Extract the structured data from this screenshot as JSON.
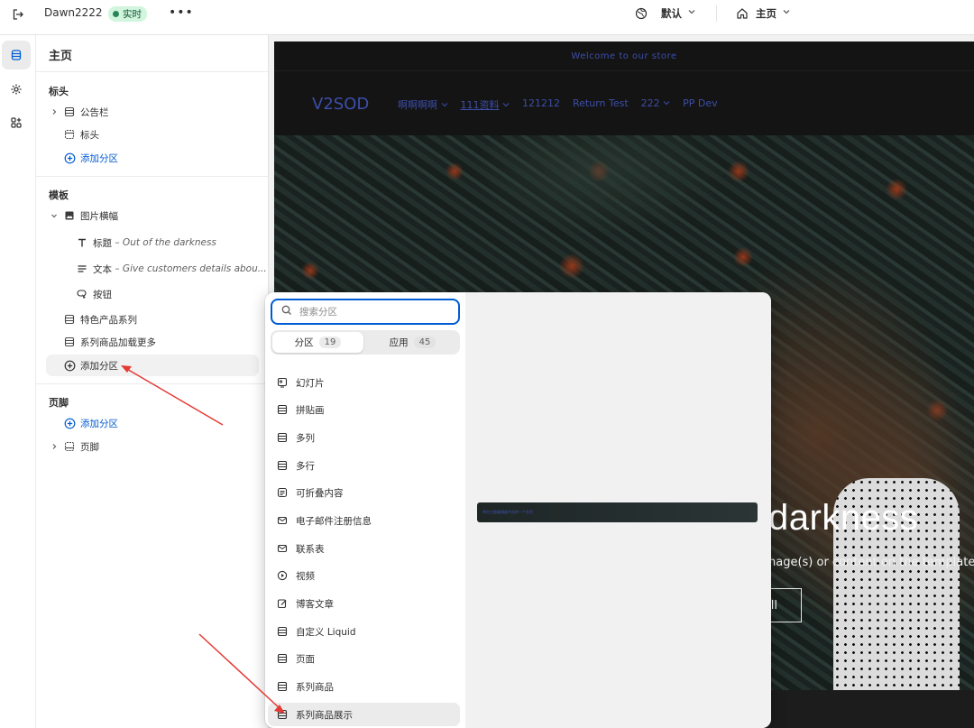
{
  "topbar": {
    "store_name": "Dawn2222",
    "live_badge": "实时",
    "more_label": "•••",
    "theme_label": "默认",
    "page_label": "主页"
  },
  "sidebar": {
    "title": "主页",
    "header_group": {
      "heading": "标头",
      "items": [
        "公告栏",
        "标头"
      ],
      "add_label": "添加分区"
    },
    "template_group": {
      "heading": "模板",
      "banner_label": "图片横幅",
      "blocks": [
        {
          "prefix": "标题",
          "detail": "– Out of the darkness"
        },
        {
          "prefix": "文本",
          "detail": "– Give customers details abou..."
        },
        {
          "prefix": "按钮",
          "detail": ""
        }
      ],
      "sections": [
        "特色产品系列",
        "系列商品加载更多"
      ],
      "add_label": "添加分区"
    },
    "footer_group": {
      "heading": "页脚",
      "add_label": "添加分区",
      "items": [
        "页脚"
      ]
    }
  },
  "preview": {
    "announcement": "Welcome to our store",
    "logo": "V2SOD",
    "nav": [
      "啊啊啊啊",
      "111资料",
      "121212",
      "Return Test",
      "222",
      "PP Dev"
    ],
    "headline": "darkness",
    "subtext": "nage(s) or content on the template.",
    "button_label": "ll"
  },
  "picker": {
    "search_placeholder": "搜索分区",
    "tabs": [
      {
        "label": "分区",
        "count": "19"
      },
      {
        "label": "应用",
        "count": "45"
      }
    ],
    "items": [
      {
        "label": "幻灯片",
        "icon": "slideshow-icon"
      },
      {
        "label": "拼贴画",
        "icon": "section-icon"
      },
      {
        "label": "多列",
        "icon": "section-icon"
      },
      {
        "label": "多行",
        "icon": "section-icon"
      },
      {
        "label": "可折叠内容",
        "icon": "collapsible-icon"
      },
      {
        "label": "电子邮件注册信息",
        "icon": "email-icon"
      },
      {
        "label": "联系表",
        "icon": "email-icon"
      },
      {
        "label": "视频",
        "icon": "video-icon"
      },
      {
        "label": "博客文章",
        "icon": "edit-icon"
      },
      {
        "label": "自定义 Liquid",
        "icon": "section-icon"
      },
      {
        "label": "页面",
        "icon": "section-icon"
      },
      {
        "label": "系列商品",
        "icon": "section-icon"
      },
      {
        "label": "系列商品展示",
        "icon": "section-icon"
      }
    ],
    "preview_thumb_text": "将在主题编辑器中选择一个系列"
  },
  "colors": {
    "accent_blue": "#005bd3",
    "live_green": "#d1f5dd",
    "annotation_red": "#e53935",
    "store_link_blue": "#3d4ea8"
  }
}
